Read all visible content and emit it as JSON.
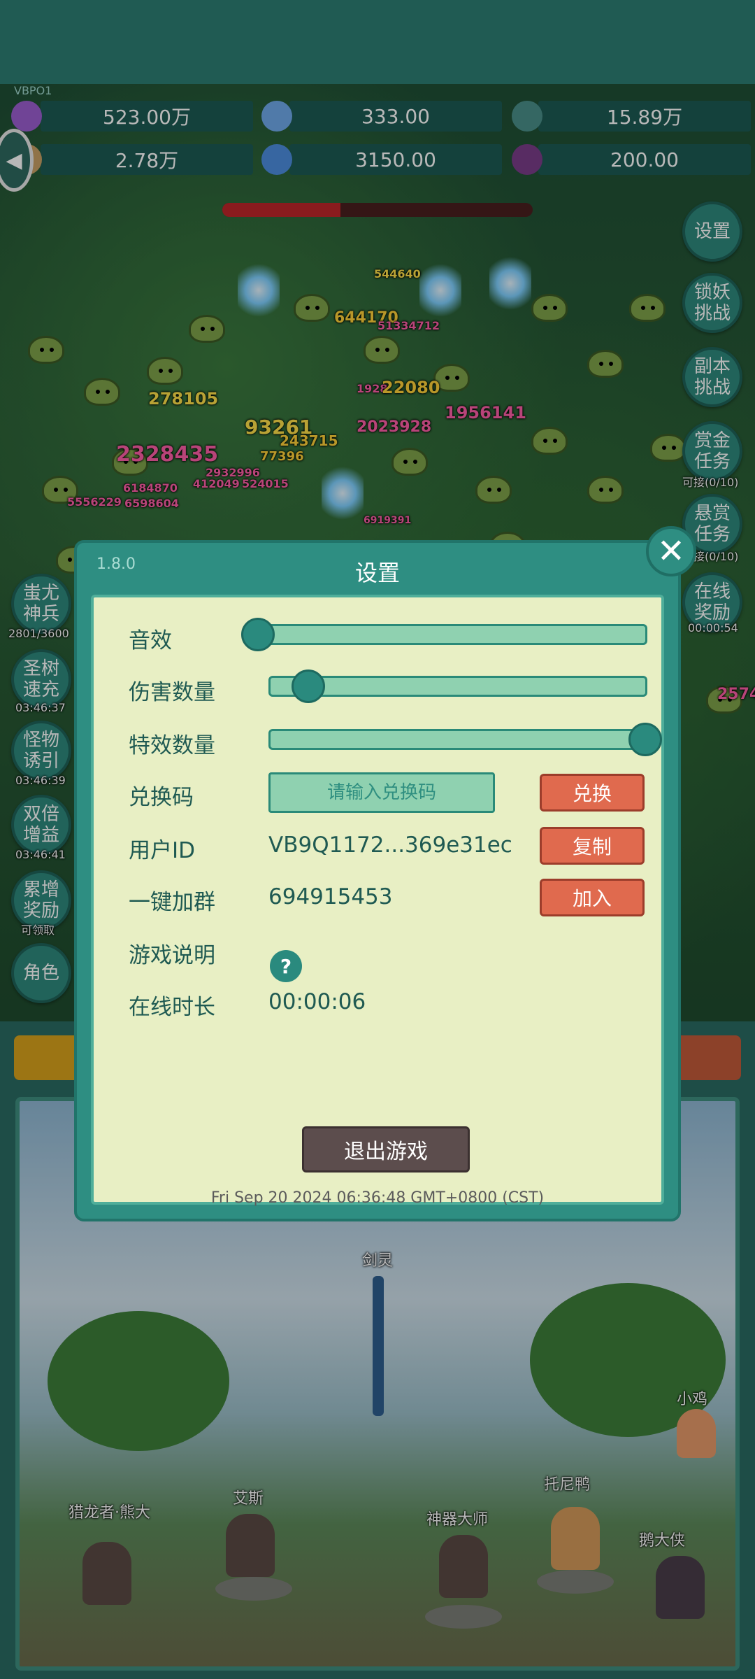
{
  "hud": {
    "version_tag": "VBPO1",
    "resources": [
      {
        "icon": "purple-gem-icon",
        "value": "523.00万",
        "color": "#9b5fd0"
      },
      {
        "icon": "blue-crystal-icon",
        "value": "333.00",
        "color": "#6fa9ea"
      },
      {
        "icon": "teal-orb-icon",
        "value": "15.89万",
        "color": "#4a8f8a"
      },
      {
        "icon": "horn-icon",
        "value": "2.78万",
        "color": "#c8a064"
      },
      {
        "icon": "blue-shard-icon",
        "value": "3150.00",
        "color": "#4d8ee0"
      },
      {
        "icon": "purple-pouch-icon",
        "value": "200.00",
        "color": "#7a3d8a"
      }
    ],
    "boss_hp_fraction": 0.38
  },
  "right_menu": [
    {
      "label": "设置",
      "note": ""
    },
    {
      "label": "锁妖挑战",
      "note": ""
    },
    {
      "label": "副本挑战",
      "note": ""
    },
    {
      "label": "赏金任务",
      "note": "可接(0/10)"
    },
    {
      "label": "悬赏任务",
      "note": "可接(0/10)"
    },
    {
      "label": "在线奖励",
      "note": "00:00:54"
    }
  ],
  "left_menu": [
    {
      "label": "蚩尤神兵",
      "note": "2801/3600"
    },
    {
      "label": "圣树速充",
      "note": "03:46:37"
    },
    {
      "label": "怪物诱引",
      "note": "03:46:39"
    },
    {
      "label": "双倍增益",
      "note": "03:46:41"
    },
    {
      "label": "累增奖励",
      "note": "可领取"
    },
    {
      "label": "角色",
      "note": ""
    }
  ],
  "damage_numbers": [
    "544640",
    "644170",
    "51334712",
    "278105",
    "1928",
    "22080",
    "1956141",
    "93261",
    "243715",
    "2023928",
    "2328435",
    "77396",
    "2932996",
    "6184870",
    "412049",
    "524015",
    "5556229",
    "6598604",
    "6919391",
    "2574"
  ],
  "settings": {
    "version": "1.8.0",
    "title": "设置",
    "close_symbol": "✕",
    "sound_label": "音效",
    "sound_level": 0.0,
    "damage_count_label": "伤害数量",
    "damage_count_level": 0.1,
    "effects_count_label": "特效数量",
    "effects_count_level": 1.0,
    "redeem_label": "兑换码",
    "redeem_placeholder": "请输入兑换码",
    "redeem_button": "兑换",
    "user_id_label": "用户ID",
    "user_id_value": "VB9Q1172...369e31ec",
    "copy_button": "复制",
    "group_label": "一键加群",
    "group_value": "694915453",
    "join_button": "加入",
    "help_label": "游戏说明",
    "help_symbol": "?",
    "online_label": "在线时长",
    "online_value": "00:00:06",
    "quit_button": "退出游戏",
    "timestamp": "Fri Sep 20 2024 06:36:48 GMT+0800 (CST)"
  },
  "scene": {
    "characters": [
      "剑灵",
      "小鸡",
      "艾斯",
      "托尼鸭",
      "猎龙者·熊大",
      "神器大师",
      "鹅大侠"
    ]
  }
}
